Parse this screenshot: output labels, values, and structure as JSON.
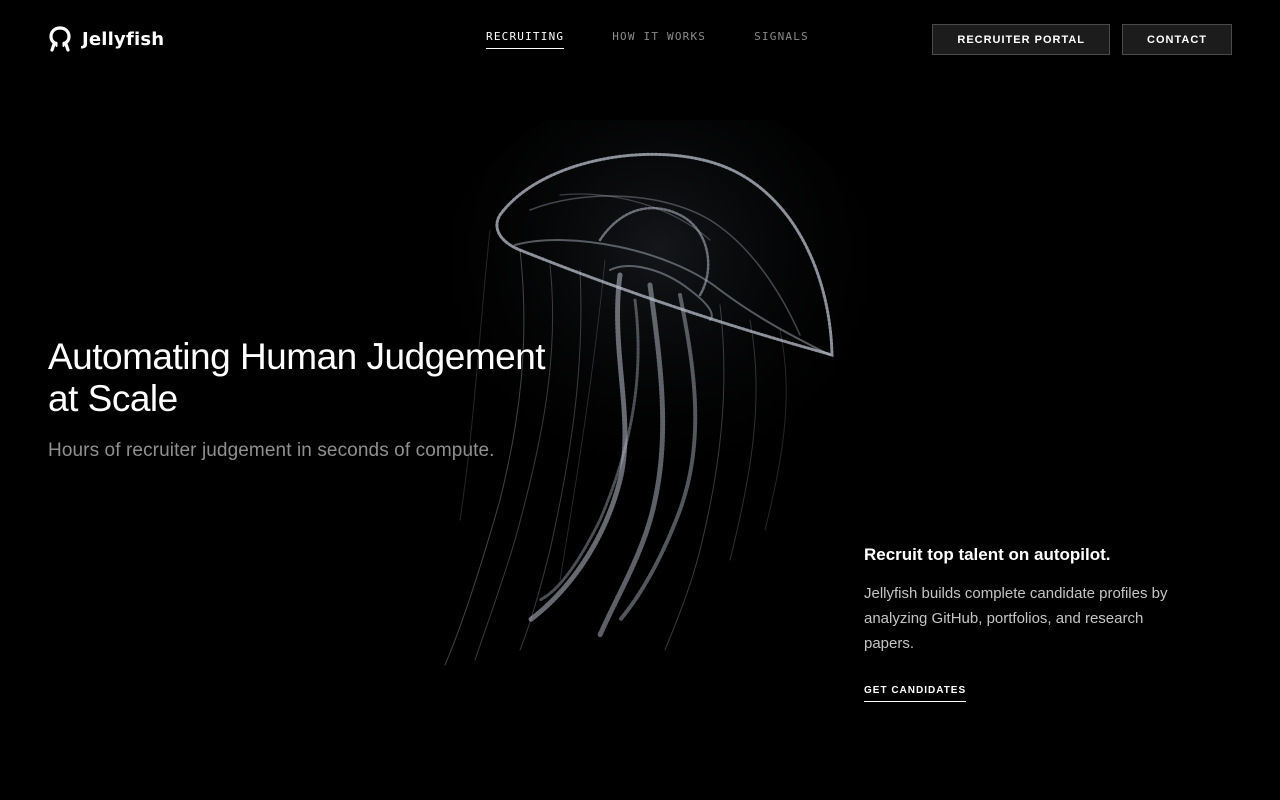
{
  "brand": {
    "name": "Jellyfish",
    "logo_icon": "jellyfish-logo-icon"
  },
  "nav": {
    "items": [
      {
        "label": "RECRUITING",
        "active": true
      },
      {
        "label": "HOW IT WORKS",
        "active": false
      },
      {
        "label": "SIGNALS",
        "active": false
      }
    ]
  },
  "header_buttons": {
    "recruiter_portal": "RECRUITER PORTAL",
    "contact": "CONTACT"
  },
  "hero": {
    "title_line1": "Automating Human Judgement",
    "title_line2": "at Scale",
    "subtitle": "Hours of recruiter judgement in seconds of compute."
  },
  "side": {
    "heading": "Recruit top talent on autopilot.",
    "body": "Jellyfish builds complete candidate profiles by analyzing GitHub, portfolios, and research papers.",
    "cta": "GET CANDIDATES"
  },
  "colors": {
    "background": "#000000",
    "text": "#ffffff",
    "muted": "#8f8f8f",
    "button_bg": "#1c1c1c",
    "button_border": "#4a4a4a"
  }
}
